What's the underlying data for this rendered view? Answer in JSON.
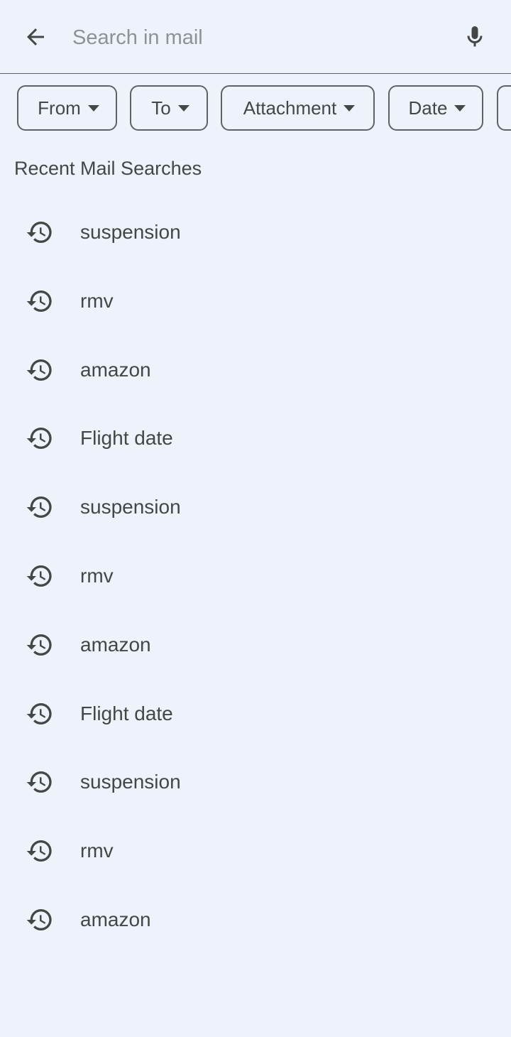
{
  "search": {
    "back_icon": "arrow-back-icon",
    "placeholder": "Search in mail",
    "value": "",
    "mic_icon": "microphone-icon"
  },
  "filters": [
    {
      "label": "From",
      "icon": "caret-down-icon"
    },
    {
      "label": "To",
      "icon": "caret-down-icon"
    },
    {
      "label": "Attachment",
      "icon": "caret-down-icon"
    },
    {
      "label": "Date",
      "icon": "caret-down-icon"
    }
  ],
  "recent": {
    "title": "Recent Mail Searches",
    "icon": "history-icon",
    "items": [
      {
        "label": "suspension"
      },
      {
        "label": "rmv"
      },
      {
        "label": "amazon"
      },
      {
        "label": "Flight date"
      },
      {
        "label": "suspension"
      },
      {
        "label": "rmv"
      },
      {
        "label": "amazon"
      },
      {
        "label": "Flight date"
      },
      {
        "label": "suspension"
      },
      {
        "label": "rmv"
      },
      {
        "label": "amazon"
      }
    ]
  },
  "colors": {
    "background": "#eef2fa",
    "text": "#444746",
    "outline": "#5f6368"
  }
}
